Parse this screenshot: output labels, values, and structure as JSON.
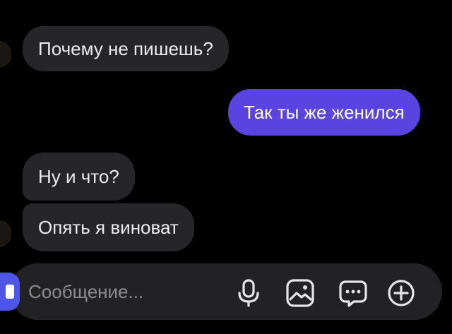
{
  "messages": [
    {
      "direction": "incoming",
      "text": "Почему не пишешь?"
    },
    {
      "direction": "outgoing",
      "text": "Так ты же женился"
    },
    {
      "direction": "incoming",
      "text": "Ну и что?"
    },
    {
      "direction": "incoming",
      "text": "Опять я виноват"
    }
  ],
  "composer": {
    "placeholder": "Сообщение...",
    "icons": [
      "send-icon",
      "microphone-icon",
      "image-icon",
      "chat-more-icon",
      "add-icon"
    ]
  },
  "colors": {
    "background": "#000000",
    "incoming_bubble": "#262628",
    "outgoing_bubble": "#5a43e0",
    "composer": "#222224",
    "send_chip": "#4d56e6"
  }
}
